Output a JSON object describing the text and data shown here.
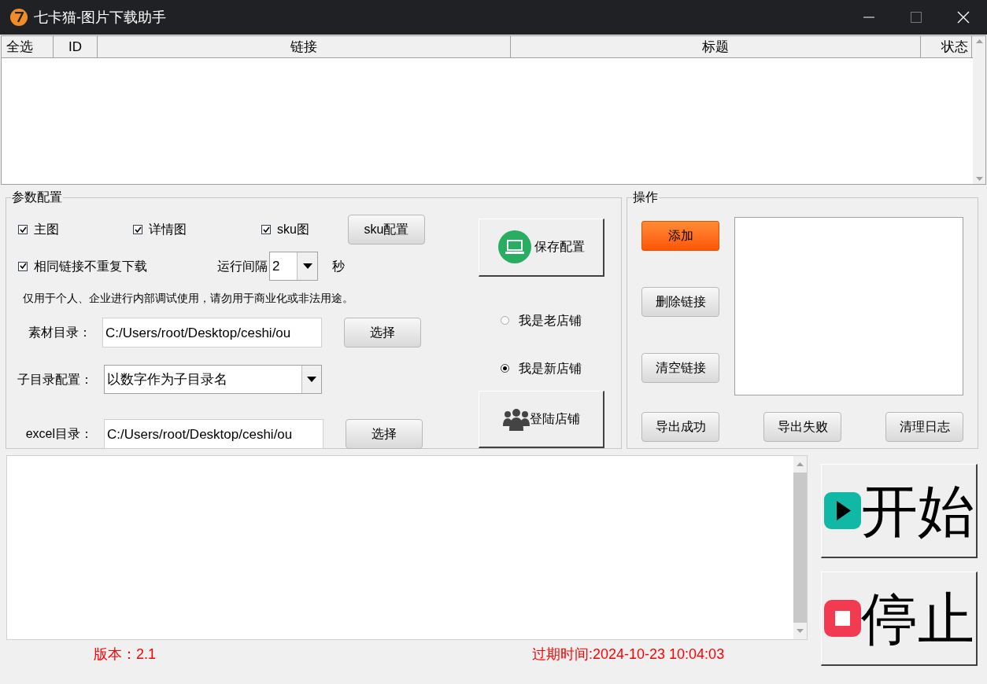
{
  "window": {
    "title": "七卡猫-图片下载助手"
  },
  "table": {
    "columns": [
      "全选",
      "ID",
      "链接",
      "标题",
      "状态"
    ]
  },
  "params": {
    "legend": "参数配置",
    "checkboxes": [
      {
        "label": "主图",
        "checked": true
      },
      {
        "label": "详情图",
        "checked": true
      },
      {
        "label": "sku图",
        "checked": true
      }
    ],
    "sku_button": "sku配置",
    "dedupe": {
      "label": "相同链接不重复下载",
      "checked": true
    },
    "interval": {
      "label": "运行间隔",
      "value": "2",
      "unit": "秒"
    },
    "notice": "仅用于个人、企业进行内部调试使用，请勿用于商业化或非法用途。",
    "material_dir": {
      "label": "素材目录：",
      "value": "C:/Users/root/Desktop/ceshi/ou",
      "button": "选择"
    },
    "subdir": {
      "label": "子目录配置：",
      "value": "以数字作为子目录名"
    },
    "excel_dir": {
      "label": "excel目录：",
      "value": "C:/Users/root/Desktop/ceshi/ou",
      "button": "选择"
    },
    "save_button": "保存配置",
    "shop_options": [
      {
        "label": "我是老店铺",
        "selected": false
      },
      {
        "label": "我是新店铺",
        "selected": true
      }
    ],
    "login_button": "登陆店铺"
  },
  "operations": {
    "legend": "操作",
    "buttons": [
      {
        "label": "添加",
        "kind": "primary"
      },
      {
        "label": "删除链接",
        "kind": "normal"
      },
      {
        "label": "清空链接",
        "kind": "normal"
      }
    ],
    "bottom_buttons": [
      {
        "label": "导出成功"
      },
      {
        "label": "导出失败"
      },
      {
        "label": "清理日志"
      }
    ]
  },
  "start_button": "开始",
  "stop_button": "停止",
  "status_bar": {
    "version": "版本：2.1",
    "expiry": "过期时间:2024-10-23 10:04:03"
  }
}
